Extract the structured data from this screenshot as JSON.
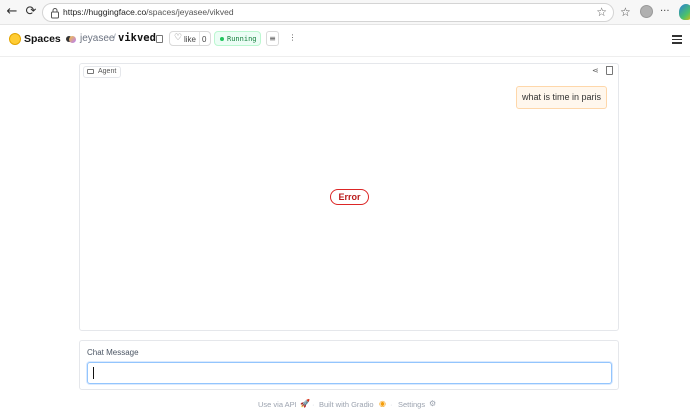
{
  "browser": {
    "url_host": "https://huggingface.co",
    "url_path": "/spaces/jeyasee/vikved",
    "back_glyph": "←",
    "reload_glyph": "⟳",
    "star_glyph": "☆",
    "favorites_glyph": "☆",
    "split_glyph": "⧉",
    "more_glyph": "···"
  },
  "header": {
    "brand": "Spaces",
    "owner": "jeyasee",
    "separator": "/",
    "repo": "vikved",
    "like_label": "like",
    "like_count": "0",
    "status": "Running",
    "status_color": "#22c55e",
    "icon_btn1_glyph": "≡",
    "icon_btn2_glyph": "⋮"
  },
  "chat": {
    "label": "Agent",
    "user_message": "what is time in paris",
    "error": "Error",
    "error_color": "#dc2626",
    "share_glyph": "⋖"
  },
  "input": {
    "label": "Chat Message",
    "value": ""
  },
  "footer": {
    "api": "Use via API",
    "api_glyph": "🚀",
    "built": "Built with Gradio",
    "gradio_glyph": "◉",
    "settings": "Settings",
    "settings_glyph": "⚙",
    "dot": "·"
  }
}
